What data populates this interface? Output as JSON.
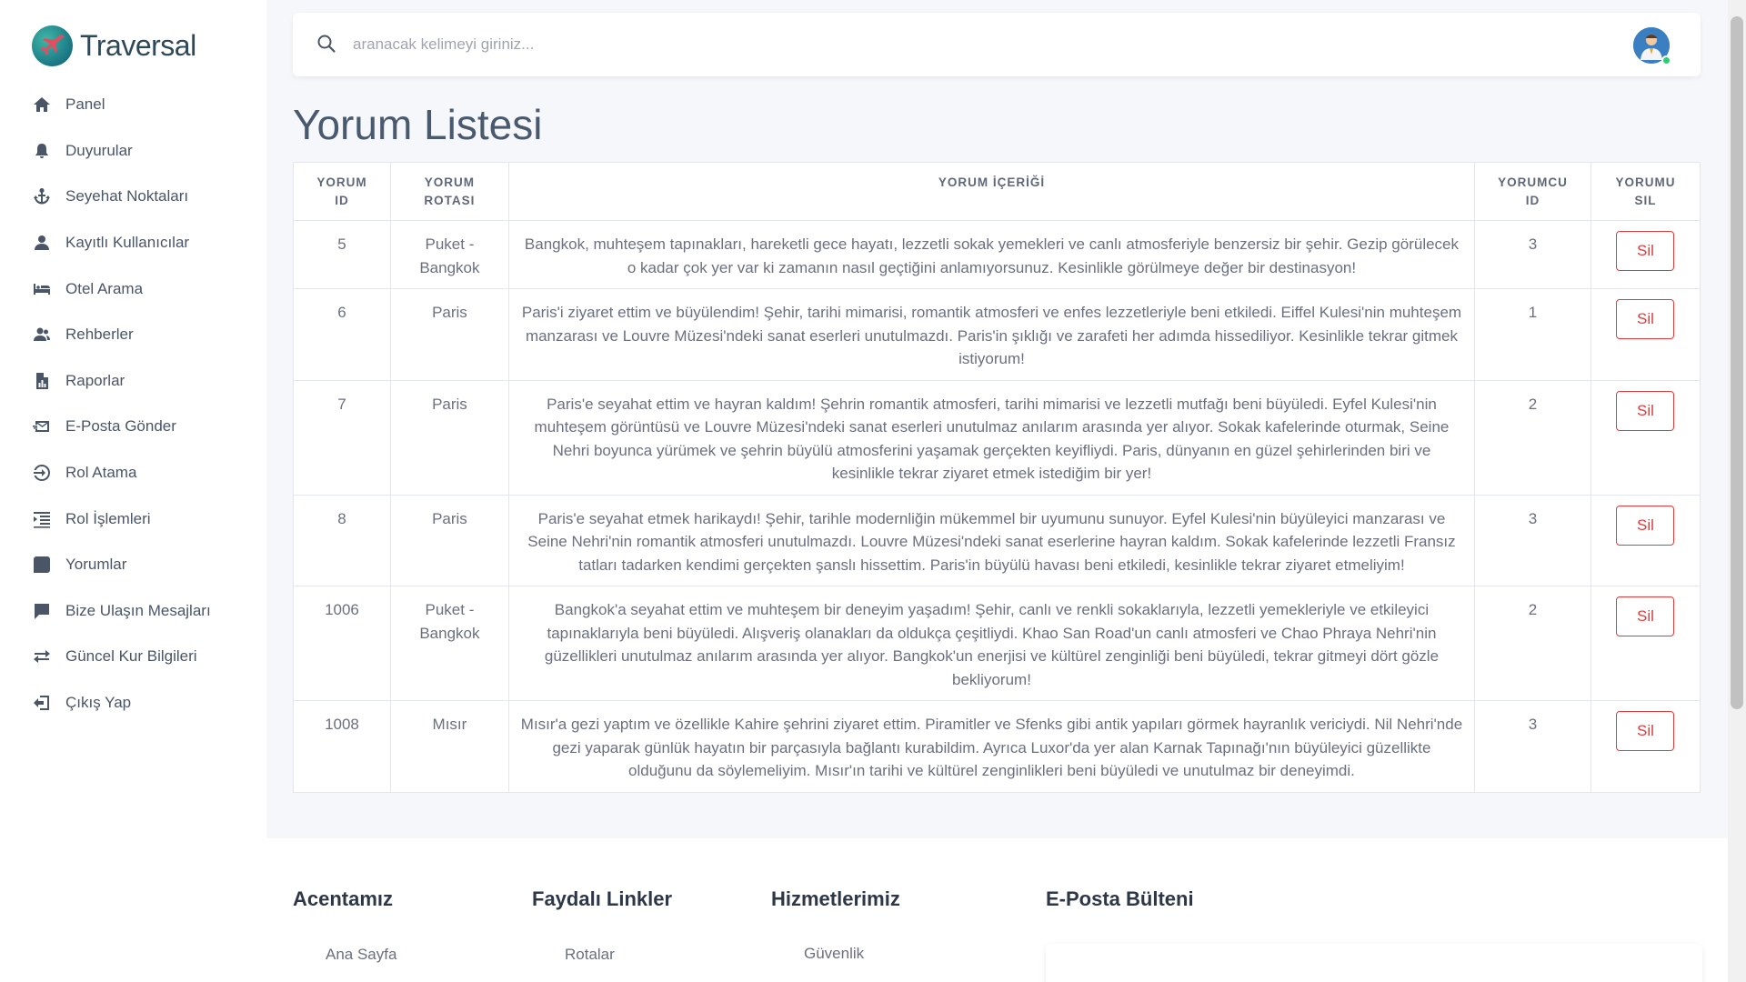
{
  "brand": {
    "name": "Traversal"
  },
  "sidebar": {
    "items": [
      {
        "label": "Panel",
        "icon": "home-icon"
      },
      {
        "label": "Duyurular",
        "icon": "bell-icon"
      },
      {
        "label": "Seyehat Noktaları",
        "icon": "anchor-icon"
      },
      {
        "label": "Kayıtlı Kullanıcılar",
        "icon": "user-icon"
      },
      {
        "label": "Otel Arama",
        "icon": "bed-icon"
      },
      {
        "label": "Rehberler",
        "icon": "users-icon"
      },
      {
        "label": "Raporlar",
        "icon": "report-icon"
      },
      {
        "label": "E-Posta Gönder",
        "icon": "mail-send-icon"
      },
      {
        "label": "Rol Atama",
        "icon": "sign-in-icon"
      },
      {
        "label": "Rol İşlemleri",
        "icon": "list-indent-icon"
      },
      {
        "label": "Yorumlar",
        "icon": "comment-icon"
      },
      {
        "label": "Bize Ulaşın Mesajları",
        "icon": "message-icon"
      },
      {
        "label": "Güncel Kur Bilgileri",
        "icon": "exchange-icon"
      },
      {
        "label": "Çıkış Yap",
        "icon": "logout-icon"
      }
    ]
  },
  "search": {
    "placeholder": "aranacak kelimeyi giriniz..."
  },
  "page": {
    "title": "Yorum Listesi"
  },
  "table": {
    "headers": {
      "id": [
        "YORUM",
        "ID"
      ],
      "route": [
        "YORUM",
        "ROTASI"
      ],
      "content": [
        "YORUM İÇERİĞİ"
      ],
      "user_id": [
        "YORUMCU",
        "ID"
      ],
      "delete": [
        "YORUMU",
        "SIL"
      ]
    },
    "delete_label": "Sil",
    "rows": [
      {
        "id": "5",
        "route": "Puket - Bangkok",
        "content": "Bangkok, muhteşem tapınakları, hareketli gece hayatı, lezzetli sokak yemekleri ve canlı atmosferiyle benzersiz bir şehir. Gezip görülecek o kadar çok yer var ki zamanın nasıl geçtiğini anlamıyorsunuz. Kesinlikle görülmeye değer bir destinasyon!",
        "user_id": "3"
      },
      {
        "id": "6",
        "route": "Paris",
        "content": "Paris'i ziyaret ettim ve büyülendim! Şehir, tarihi mimarisi, romantik atmosferi ve enfes lezzetleriyle beni etkiledi. Eiffel Kulesi'nin muhteşem manzarası ve Louvre Müzesi'ndeki sanat eserleri unutulmazdı. Paris'in şıklığı ve zarafeti her adımda hissediliyor. Kesinlikle tekrar gitmek istiyorum!",
        "user_id": "1"
      },
      {
        "id": "7",
        "route": "Paris",
        "content": "Paris'e seyahat ettim ve hayran kaldım! Şehrin romantik atmosferi, tarihi mimarisi ve lezzetli mutfağı beni büyüledi. Eyfel Kulesi'nin muhteşem görüntüsü ve Louvre Müzesi'ndeki sanat eserleri unutulmaz anılarım arasında yer alıyor. Sokak kafelerinde oturmak, Seine Nehri boyunca yürümek ve şehrin büyülü atmosferini yaşamak gerçekten keyifliydi. Paris, dünyanın en güzel şehirlerinden biri ve kesinlikle tekrar ziyaret etmek istediğim bir yer!",
        "user_id": "2"
      },
      {
        "id": "8",
        "route": "Paris",
        "content": "Paris'e seyahat etmek harikaydı! Şehir, tarihle modernliğin mükemmel bir uyumunu sunuyor. Eyfel Kulesi'nin büyüleyici manzarası ve Seine Nehri'nin romantik atmosferi unutulmazdı. Louvre Müzesi'ndeki sanat eserlerine hayran kaldım. Sokak kafelerinde lezzetli Fransız tatları tadarken kendimi gerçekten şanslı hissettim. Paris'in büyülü havası beni etkiledi, kesinlikle tekrar ziyaret etmeliyim!",
        "user_id": "3"
      },
      {
        "id": "1006",
        "route": "Puket - Bangkok",
        "content": "Bangkok'a seyahat ettim ve muhteşem bir deneyim yaşadım! Şehir, canlı ve renkli sokaklarıyla, lezzetli yemekleriyle ve etkileyici tapınaklarıyla beni büyüledi. Alışveriş olanakları da oldukça çeşitliydi. Khao San Road'un canlı atmosferi ve Chao Phraya Nehri'nin güzellikleri unutulmaz anılarım arasında yer alıyor. Bangkok'un enerjisi ve kültürel zenginliği beni büyüledi, tekrar gitmeyi dört gözle bekliyorum!",
        "user_id": "2"
      },
      {
        "id": "1008",
        "route": "Mısır",
        "content": "Mısır'a gezi yaptım ve özellikle Kahire şehrini ziyaret ettim. Piramitler ve Sfenks gibi antik yapıları görmek hayranlık vericiydi. Nil Nehri'nde gezi yaparak günlük hayatın bir parçasıyla bağlantı kurabildim. Ayrıca Luxor'da yer alan Karnak Tapınağı'nın büyüleyici güzellikte olduğunu da söylemeliyim. Mısır'ın tarihi ve kültürel zenginlikleri beni büyüledi ve unutulmaz bir deneyimdi.",
        "user_id": "3"
      }
    ]
  },
  "footer": {
    "columns": [
      {
        "heading": "Acentamız",
        "first_link": "Ana Sayfa"
      },
      {
        "heading": "Faydalı Linkler",
        "first_link": "Rotalar"
      },
      {
        "heading": "Hizmetlerimiz",
        "first_link": "Güvenlik"
      },
      {
        "heading": "E-Posta Bülteni"
      }
    ]
  },
  "colors": {
    "accent_danger": "#e23b3b",
    "sidebar_text": "#4a5568",
    "title_text": "#4a5a6e"
  }
}
